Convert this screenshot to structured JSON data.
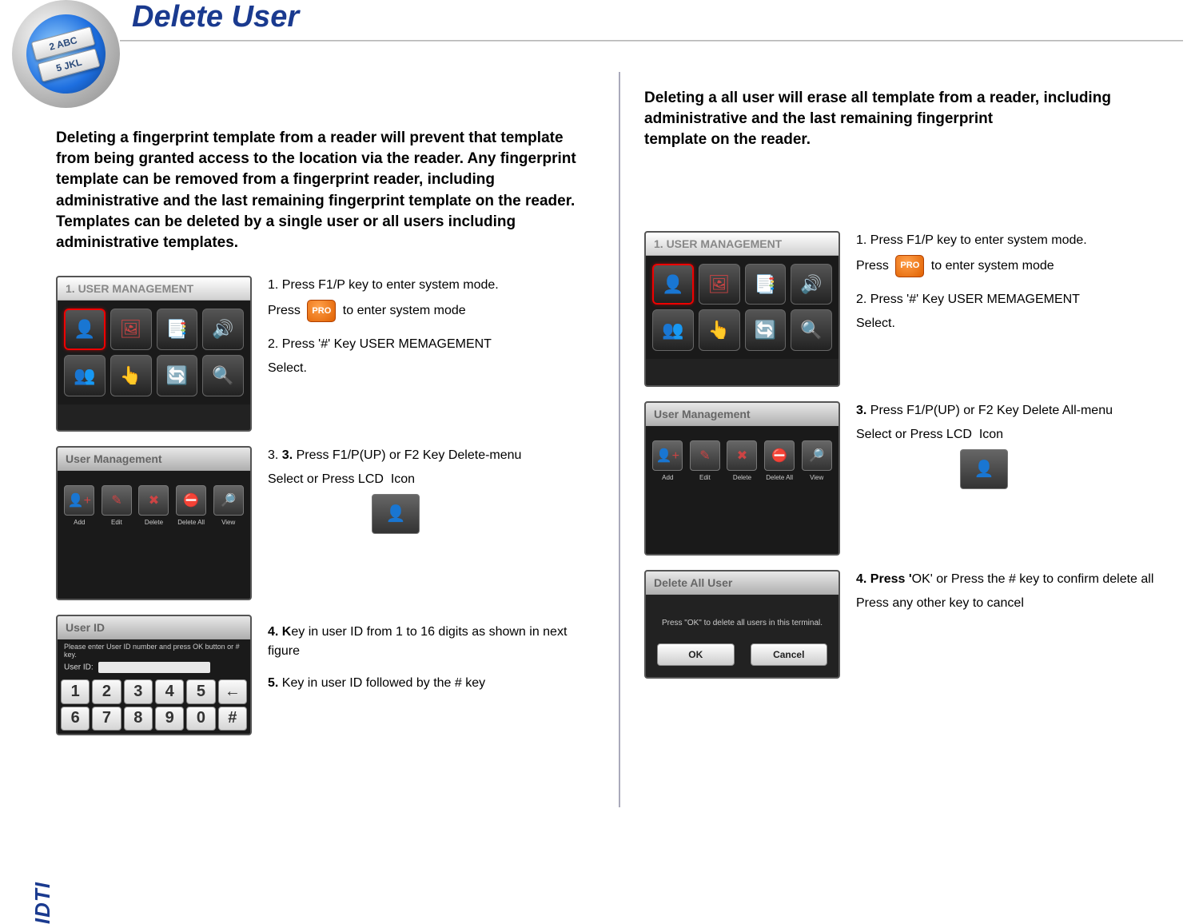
{
  "page_title": "Delete User",
  "disc_keys": [
    "2 ABC",
    "5 JKL"
  ],
  "side_logo": "IDTI",
  "left": {
    "intro": "Deleting a fingerprint template from a reader will prevent that template from being granted access to the location via the reader. Any fingerprint template can be removed from a fingerprint reader, including administrative and the last remaining fingerprint template on the reader. Templates can be deleted by a single user or all users including administrative templates.",
    "rows": [
      {
        "screen": {
          "type": "grid4x2",
          "title": "1. USER MANAGEMENT"
        },
        "steps": [
          {
            "num": "1.",
            "text_pre": "Press F1/P key to enter system mode."
          },
          {
            "text_pre": "Press ",
            "badge": "PRO",
            "text_post": " to enter system mode"
          },
          null,
          {
            "num": "2.",
            "text_pre": "Press '#' Key USER MEMAGEMENT"
          },
          {
            "text_pre": "Select."
          }
        ]
      },
      {
        "screen": {
          "type": "menu5",
          "title": "User Management",
          "items": [
            "Add",
            "Edit",
            "Delete",
            "Delete All",
            "View"
          ]
        },
        "steps": [
          {
            "num": "3.",
            "bold_pre": "3.",
            "text_pre": " Press  F1/P(UP) or F2 Key   Delete-menu"
          },
          {
            "text_pre": "Select or  Press LCD ",
            "inline_icon": true,
            "text_post": "  Icon"
          },
          {
            "big_icon": true
          }
        ]
      },
      {
        "screen": {
          "type": "keypad",
          "title": "User ID",
          "hint": "Please enter User ID number and press OK button or # key.",
          "uid_label": "User ID:",
          "keys": [
            "1",
            "2",
            "3",
            "4",
            "5",
            "←",
            "6",
            "7",
            "8",
            "9",
            "0",
            "#"
          ]
        },
        "steps": [
          null,
          {
            "bold_pre": "4. K",
            "text_pre": "ey in user ID from 1 to 16 digits as shown in next figure"
          },
          null,
          {
            "bold_pre": "5.",
            "text_pre": " Key in user ID followed by the # key"
          }
        ]
      }
    ]
  },
  "right": {
    "intro": "Deleting a all user will erase all template from a reader, including administrative and the last remaining fingerprint\ntemplate on the reader.",
    "rows": [
      {
        "screen": {
          "type": "grid4x2",
          "title": "1. USER MANAGEMENT"
        },
        "steps": [
          {
            "num": "1.",
            "text_pre": "Press F1/P key to enter system mode."
          },
          {
            "text_pre": "Press ",
            "badge": "PRO",
            "text_post": " to enter system mode"
          },
          null,
          {
            "num": "2.",
            "text_pre": "Press '#' Key USER MEMAGEMENT"
          },
          {
            "text_pre": "Select."
          }
        ]
      },
      {
        "screen": {
          "type": "menu5",
          "title": "User Management",
          "items": [
            "Add",
            "Edit",
            "Delete",
            "Delete All",
            "View"
          ]
        },
        "steps": [
          {
            "bold_pre": "3.",
            "text_pre": " Press  F1/P(UP) or F2 Key   Delete All-menu"
          },
          {
            "text_pre": "Select or  Press LCD ",
            "inline_icon": true,
            "text_post": "  Icon"
          },
          {
            "big_icon": true
          }
        ]
      },
      {
        "screen": {
          "type": "dialog",
          "title": "Delete All User",
          "message": "Press \"OK\" to delete all users in this terminal.",
          "ok": "OK",
          "cancel": "Cancel"
        },
        "steps": [
          {
            "bold_pre": "4. Press '",
            "text_pre": "OK'  or Press the # key to confirm delete all"
          },
          {
            "text_pre": "Press any other key to cancel"
          }
        ]
      }
    ]
  }
}
